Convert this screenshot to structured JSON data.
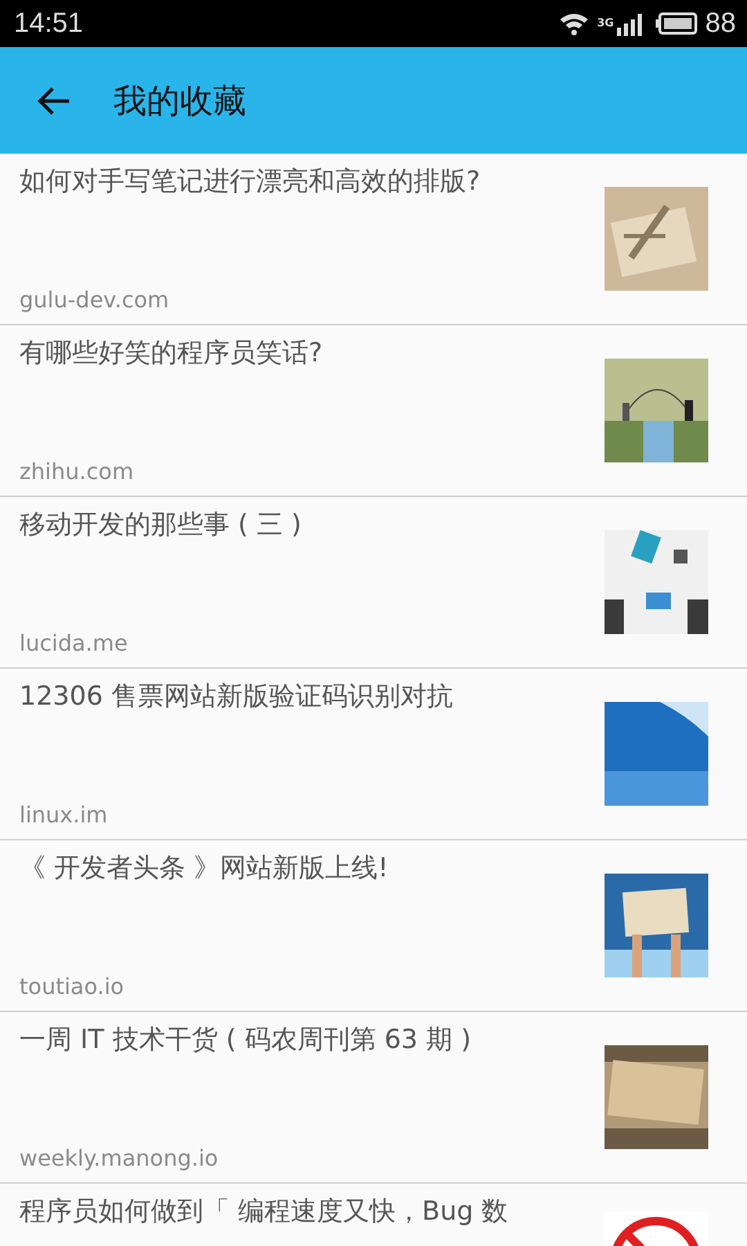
{
  "status_bar": {
    "time": "14:51",
    "network": "3G",
    "battery": "88"
  },
  "toolbar": {
    "title": "我的收藏"
  },
  "items": [
    {
      "title": "如何对手写笔记进行漂亮和高效的排版?",
      "source": "gulu-dev.com"
    },
    {
      "title": "有哪些好笑的程序员笑话?",
      "source": "zhihu.com"
    },
    {
      "title": "移动开发的那些事 ( 三 )",
      "source": "lucida.me"
    },
    {
      "title": "12306 售票网站新版验证码识别对抗",
      "source": "linux.im"
    },
    {
      "title": "《 开发者头条 》网站新版上线!",
      "source": "toutiao.io"
    },
    {
      "title": "一周 IT 技术干货 ( 码农周刊第 63 期 )",
      "source": "weekly.manong.io"
    },
    {
      "title": "程序员如何做到「 编程速度又快，Bug 数"
    }
  ]
}
